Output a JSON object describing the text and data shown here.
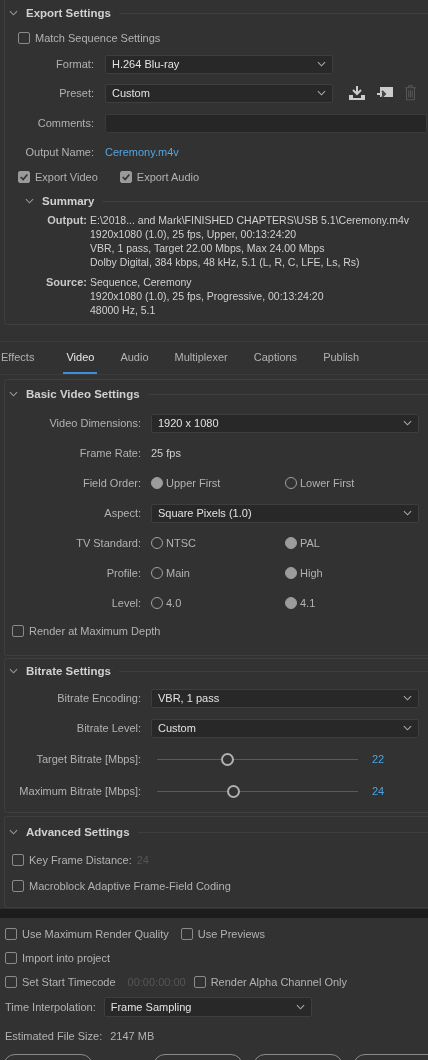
{
  "export_settings": {
    "title": "Export Settings",
    "match_sequence": {
      "label": "Match Sequence Settings",
      "checked": false
    },
    "fields": [
      {
        "kind": "select",
        "label": "Format:",
        "value": "H.264 Blu-ray"
      },
      {
        "kind": "preset",
        "label": "Preset:",
        "value": "Custom"
      },
      {
        "kind": "input",
        "label": "Comments:"
      },
      {
        "kind": "link",
        "label": "Output Name:",
        "value": "Ceremony.m4v"
      }
    ],
    "exports": [
      {
        "label": "Export Video",
        "checked": true
      },
      {
        "label": "Export Audio",
        "checked": true
      }
    ],
    "summary": {
      "title": "Summary",
      "blocks": [
        {
          "label": "Output:",
          "lines": [
            "E:\\2018... and Mark\\FINISHED CHAPTERS\\USB 5.1\\Ceremony.m4v",
            "1920x1080 (1.0), 25 fps, Upper, 00:13:24:20",
            "VBR, 1 pass, Target 22.00 Mbps, Max 24.00 Mbps",
            "Dolby Digital, 384 kbps, 48 kHz, 5.1 (L, R, C, LFE, Ls, Rs)"
          ]
        },
        {
          "label": "Source:",
          "lines": [
            "Sequence, Ceremony",
            "1920x1080 (1.0), 25 fps, Progressive, 00:13:24:20",
            "48000 Hz, 5.1"
          ]
        }
      ]
    }
  },
  "tabs": [
    {
      "label": "Effects",
      "selected": false
    },
    {
      "label": "Video",
      "selected": true
    },
    {
      "label": "Audio",
      "selected": false
    },
    {
      "label": "Multiplexer",
      "selected": false
    },
    {
      "label": "Captions",
      "selected": false
    },
    {
      "label": "Publish",
      "selected": false
    }
  ],
  "sections": [
    {
      "title": "Basic Video Settings",
      "rows": [
        {
          "kind": "select",
          "label": "Video Dimensions:",
          "value": "1920 x 1080"
        },
        {
          "kind": "text",
          "label": "Frame Rate:",
          "value": "25 fps"
        },
        {
          "kind": "radio",
          "label": "Field Order:",
          "options": [
            {
              "label": "Upper First",
              "selected": true
            },
            {
              "label": "Lower First",
              "selected": false
            }
          ]
        },
        {
          "kind": "select",
          "label": "Aspect:",
          "value": "Square Pixels (1.0)"
        },
        {
          "kind": "radio",
          "label": "TV Standard:",
          "options": [
            {
              "label": "NTSC",
              "selected": false
            },
            {
              "label": "PAL",
              "selected": true
            }
          ]
        },
        {
          "kind": "radio",
          "label": "Profile:",
          "options": [
            {
              "label": "Main",
              "selected": false
            },
            {
              "label": "High",
              "selected": true
            }
          ]
        },
        {
          "kind": "radio",
          "label": "Level:",
          "options": [
            {
              "label": "4.0",
              "selected": false
            },
            {
              "label": "4.1",
              "selected": true
            }
          ]
        },
        {
          "kind": "checkbox",
          "label": "Render at Maximum Depth",
          "checked": false
        }
      ]
    },
    {
      "title": "Bitrate Settings",
      "rows": [
        {
          "kind": "select",
          "label": "Bitrate Encoding:",
          "value": "VBR, 1 pass"
        },
        {
          "kind": "select",
          "label": "Bitrate Level:",
          "value": "Custom"
        },
        {
          "kind": "slider",
          "label": "Target Bitrate [Mbps]:",
          "level": 0.35,
          "reading": "22"
        },
        {
          "kind": "slider",
          "label": "Maximum Bitrate [Mbps]:",
          "level": 0.38,
          "reading": "24"
        }
      ]
    },
    {
      "title": "Advanced Settings",
      "rows": [
        {
          "kind": "checkbox",
          "label": "Key Frame Distance:",
          "checked": false,
          "value": "24"
        },
        {
          "kind": "checkbox",
          "label": "Macroblock Adaptive Frame-Field Coding",
          "checked": false
        }
      ]
    }
  ],
  "render_options": [
    {
      "items": [
        {
          "label": "Use Maximum Render Quality",
          "checked": false
        },
        {
          "label": "Use Previews",
          "checked": false
        }
      ]
    },
    {
      "items": [
        {
          "label": "Import into project",
          "checked": false
        }
      ]
    },
    {
      "items": [
        {
          "label": "Set Start Timecode",
          "checked": false,
          "value": "00:00:00:00"
        },
        {
          "label": "Render Alpha Channel Only",
          "checked": false
        }
      ]
    }
  ],
  "time_interpolation": {
    "label": "Time Interpolation:",
    "value": "Frame Sampling"
  },
  "estimated_size": {
    "label": "Estimated File Size:",
    "value": "2147 MB"
  }
}
